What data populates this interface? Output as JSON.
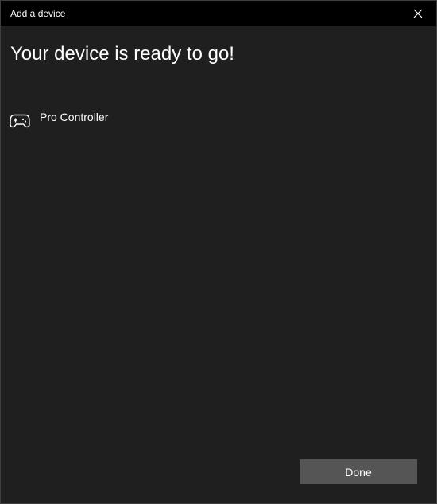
{
  "window": {
    "title": "Add a device"
  },
  "main": {
    "heading": "Your device is ready to go!",
    "device": {
      "name": "Pro Controller",
      "icon": "gamepad-icon"
    }
  },
  "footer": {
    "done_label": "Done"
  },
  "colors": {
    "titlebar_bg": "#000000",
    "window_bg": "#1f1f1f",
    "button_bg": "#555555",
    "text": "#ffffff"
  }
}
